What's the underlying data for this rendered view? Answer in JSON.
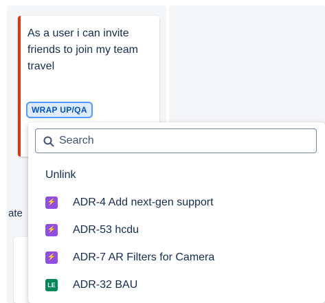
{
  "card": {
    "summary": "As a user i can invite friends to join my team travel",
    "status": "WRAP UP/QA",
    "accent_color": "#de350b"
  },
  "background": {
    "partial_text": "ate"
  },
  "dropdown": {
    "search_placeholder": "Search",
    "search_value": "",
    "unlink_label": "Unlink",
    "items": [
      {
        "badge": "⚡",
        "label": "ADR-4 Add next-gen support",
        "badge_color": "#904ee2"
      },
      {
        "badge": "⚡",
        "label": "ADR-53 hcdu",
        "badge_color": "#904ee2"
      },
      {
        "badge": "⚡",
        "label": "ADR-7 AR Filters for Camera",
        "badge_color": "#904ee2"
      },
      {
        "badge": "LE",
        "label": "ADR-32 BAU",
        "badge_color": "#00875a"
      }
    ]
  }
}
